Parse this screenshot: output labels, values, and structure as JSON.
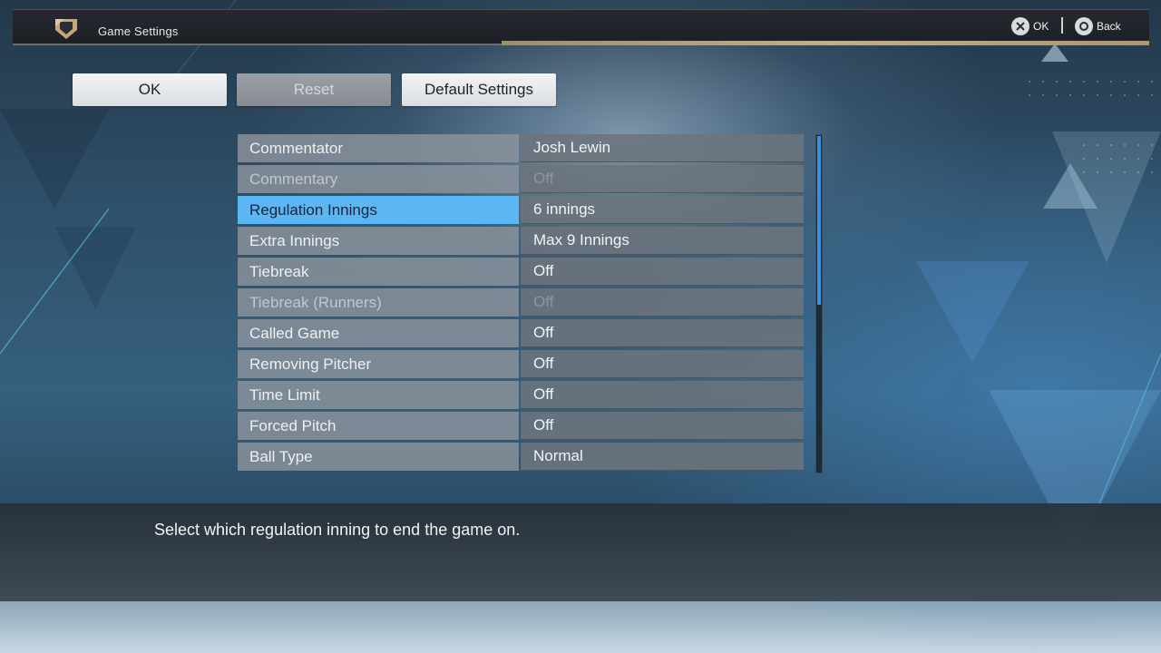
{
  "header": {
    "title": "Game Settings",
    "hint_ok": "OK",
    "hint_back": "Back"
  },
  "buttons": {
    "ok": "OK",
    "reset": "Reset",
    "default": "Default Settings"
  },
  "settings": [
    {
      "label": "Commentator",
      "value": "Josh  Lewin",
      "state": "normal"
    },
    {
      "label": "Commentary",
      "value": "Off",
      "state": "disabled"
    },
    {
      "label": "Regulation  Innings",
      "value": "6  innings",
      "state": "selected"
    },
    {
      "label": "Extra  Innings",
      "value": "Max  9  Innings",
      "state": "normal"
    },
    {
      "label": "Tiebreak",
      "value": "Off",
      "state": "normal"
    },
    {
      "label": "Tiebreak  (Runners)",
      "value": "Off",
      "state": "disabled"
    },
    {
      "label": "Called  Game",
      "value": "Off",
      "state": "normal"
    },
    {
      "label": "Removing  Pitcher",
      "value": "Off",
      "state": "normal"
    },
    {
      "label": "Time  Limit",
      "value": "Off",
      "state": "normal"
    },
    {
      "label": "Forced  Pitch",
      "value": "Off",
      "state": "normal"
    },
    {
      "label": "Ball  Type",
      "value": "Normal",
      "state": "normal"
    }
  ],
  "description": "Select  which  regulation  inning  to  end  the  game  on.",
  "colors": {
    "selected_row": "#5db6f4",
    "accent_gold": "#c9ac7c",
    "scroll_thumb": "#3d8fdf"
  },
  "icons": {
    "logo": "home-plate-logo",
    "ok_button_glyph": "cross-button-icon",
    "back_button_glyph": "circle-button-icon"
  }
}
